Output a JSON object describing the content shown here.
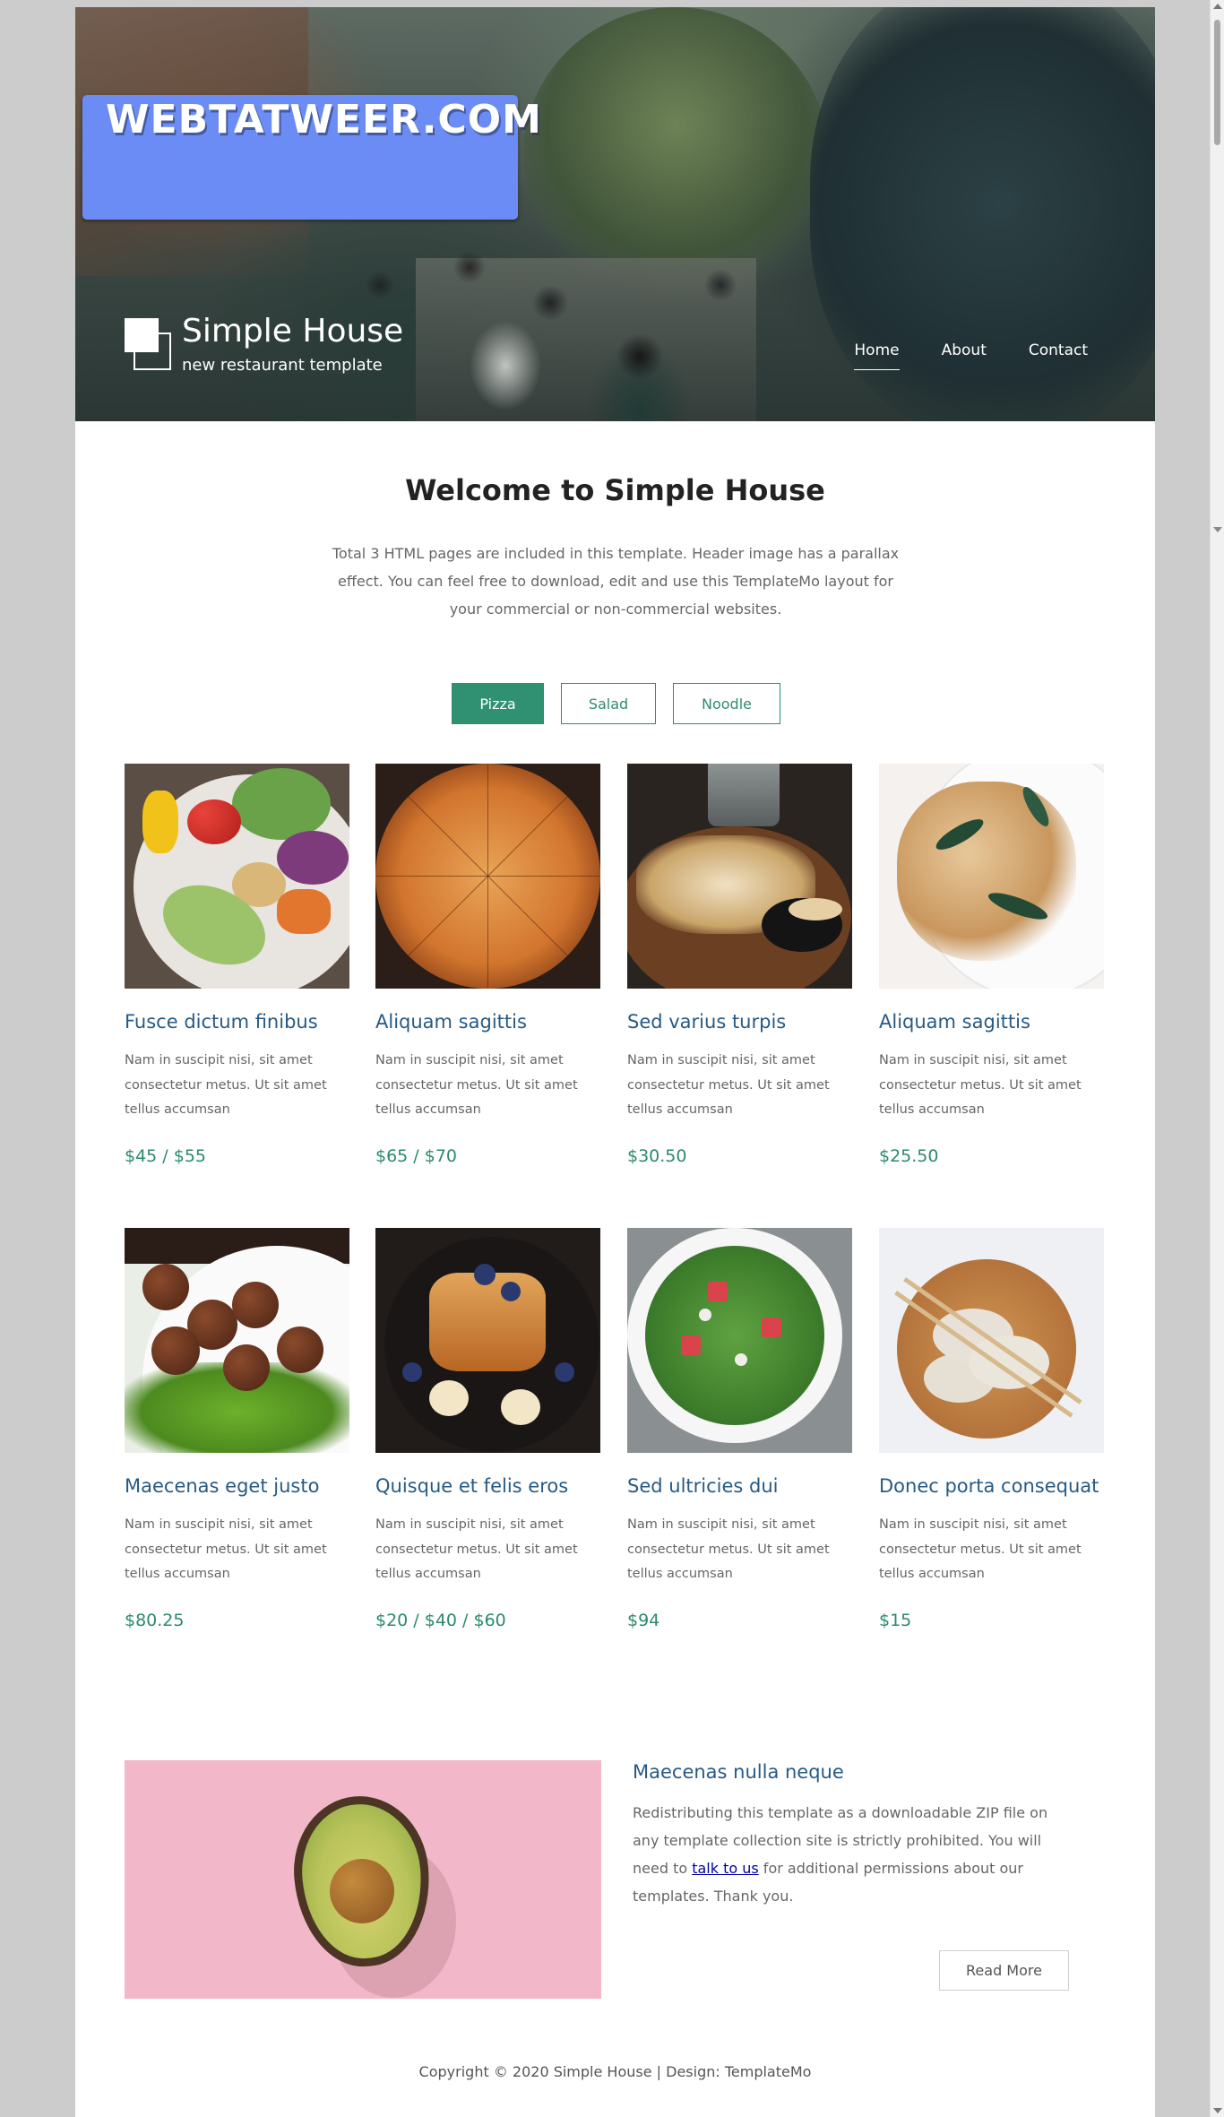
{
  "watermark": {
    "text": "WEBTATWEER.COM"
  },
  "brand": {
    "title": "Simple House",
    "subtitle": "new restaurant template"
  },
  "nav": {
    "items": [
      {
        "label": "Home",
        "active": true
      },
      {
        "label": "About",
        "active": false
      },
      {
        "label": "Contact",
        "active": false
      }
    ]
  },
  "welcome": {
    "title": "Welcome to Simple House",
    "text": "Total 3 HTML pages are included in this template. Header image has a parallax effect. You can feel free to download, edit and use this TemplateMo layout for your commercial or non-commercial websites."
  },
  "tabs": [
    {
      "label": "Pizza",
      "active": true
    },
    {
      "label": "Salad",
      "active": false
    },
    {
      "label": "Noodle",
      "active": false
    }
  ],
  "items": [
    {
      "title": "Fusce dictum finibus",
      "desc": "Nam in suscipit nisi, sit amet consectetur metus. Ut sit amet tellus accumsan",
      "price": "$45 / $55"
    },
    {
      "title": "Aliquam sagittis",
      "desc": "Nam in suscipit nisi, sit amet consectetur metus. Ut sit amet tellus accumsan",
      "price": "$65 / $70"
    },
    {
      "title": "Sed varius turpis",
      "desc": "Nam in suscipit nisi, sit amet consectetur metus. Ut sit amet tellus accumsan",
      "price": "$30.50"
    },
    {
      "title": "Aliquam sagittis",
      "desc": "Nam in suscipit nisi, sit amet consectetur metus. Ut sit amet tellus accumsan",
      "price": "$25.50"
    },
    {
      "title": "Maecenas eget justo",
      "desc": "Nam in suscipit nisi, sit amet consectetur metus. Ut sit amet tellus accumsan",
      "price": "$80.25"
    },
    {
      "title": "Quisque et felis eros",
      "desc": "Nam in suscipit nisi, sit amet consectetur metus. Ut sit amet tellus accumsan",
      "price": "$20 / $40 / $60"
    },
    {
      "title": "Sed ultricies dui",
      "desc": "Nam in suscipit nisi, sit amet consectetur metus. Ut sit amet tellus accumsan",
      "price": "$94"
    },
    {
      "title": "Donec porta consequat",
      "desc": "Nam in suscipit nisi, sit amet consectetur metus. Ut sit amet tellus accumsan",
      "price": "$15"
    }
  ],
  "feature": {
    "title": "Maecenas nulla neque",
    "text_before": "Redistributing this template as a downloadable ZIP file on any template collection site is strictly prohibited. You will need to ",
    "link": "talk to us",
    "text_after": " for additional permissions about our templates. Thank you.",
    "button": "Read More"
  },
  "footer": {
    "text": "Copyright © 2020 Simple House | Design: TemplateMo"
  },
  "colors": {
    "accent": "#2f9171",
    "title_blue": "#265a85",
    "watermark_bg": "#6b8cf4"
  }
}
